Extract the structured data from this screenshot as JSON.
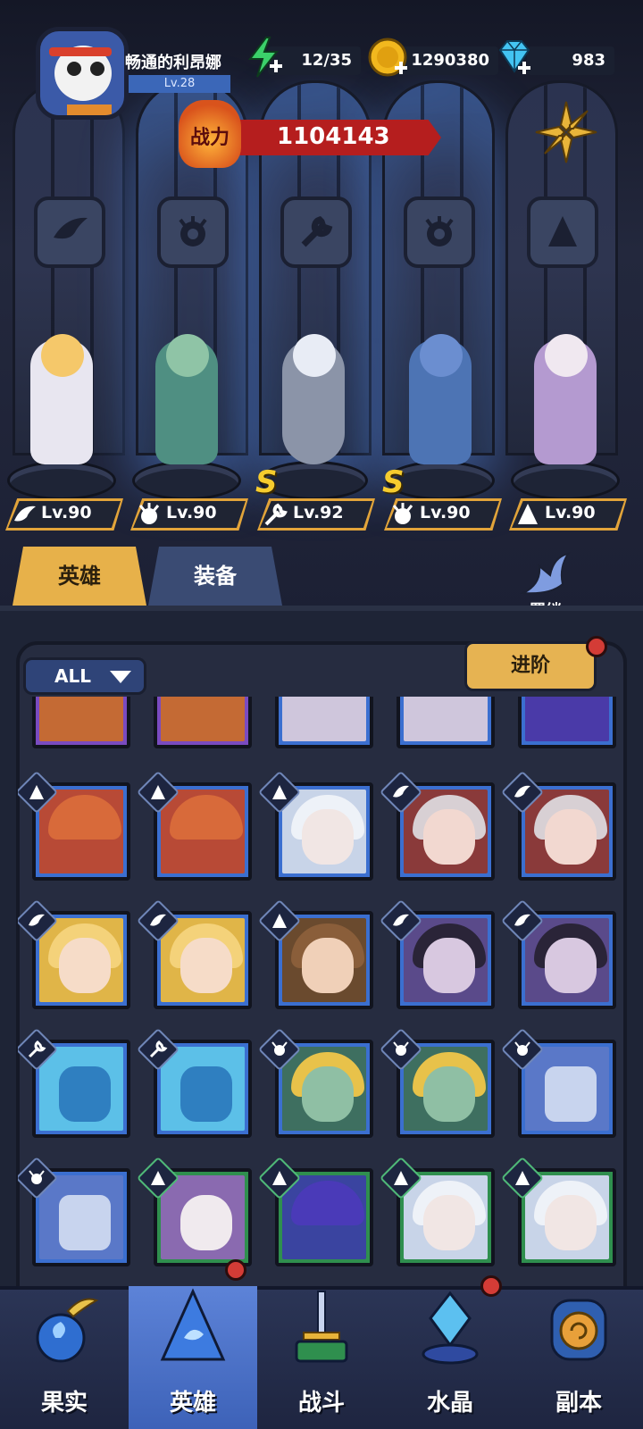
{
  "player": {
    "name": "畅通的利昂娜",
    "level": "Lv.28"
  },
  "resources": {
    "energy": "12/35",
    "gold": "1290380",
    "gems": "983"
  },
  "power": {
    "label": "战力",
    "value": "1104143"
  },
  "heroes": [
    {
      "level": "Lv.90",
      "class_icon": "wing-icon",
      "s_rank": false
    },
    {
      "level": "Lv.90",
      "class_icon": "beast-crest-icon",
      "s_rank": false
    },
    {
      "level": "Lv.92",
      "class_icon": "wrench-icon",
      "s_rank": true
    },
    {
      "level": "Lv.90",
      "class_icon": "beast-crest-icon",
      "s_rank": true
    },
    {
      "level": "Lv.90",
      "class_icon": "mage-hat-icon",
      "s_rank": false
    }
  ],
  "tabs": {
    "heroes": "英雄",
    "equipment": "装备"
  },
  "bond": {
    "label": "羁绊"
  },
  "filter": {
    "label": "ALL"
  },
  "advance": {
    "label": "进阶"
  },
  "nav": [
    {
      "label": "果实",
      "icon": "fruit-icon"
    },
    {
      "label": "英雄",
      "icon": "hero-hat-icon"
    },
    {
      "label": "战斗",
      "icon": "sword-icon"
    },
    {
      "label": "水晶",
      "icon": "crystal-icon"
    },
    {
      "label": "副本",
      "icon": "portal-icon"
    }
  ],
  "colors": {
    "gold": "#e6b352",
    "blue_frame": "#3b6fd0",
    "purple_frame": "#7a4bc0",
    "green_frame": "#2f8f4e",
    "red": "#b51e1e"
  }
}
